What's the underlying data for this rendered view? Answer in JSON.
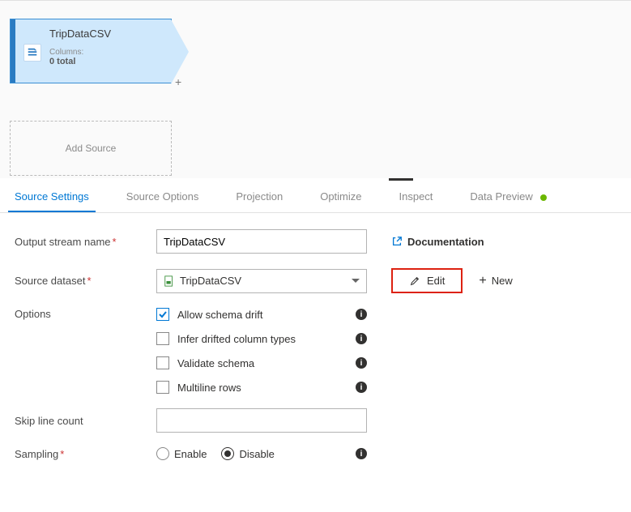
{
  "node": {
    "title": "TripDataCSV",
    "columnsLabel": "Columns:",
    "columnsCount": "0 total"
  },
  "addSource": "Add Source",
  "tabs": {
    "source_settings": "Source Settings",
    "source_options": "Source Options",
    "projection": "Projection",
    "optimize": "Optimize",
    "inspect": "Inspect",
    "data_preview": "Data Preview"
  },
  "labels": {
    "output_stream": "Output stream name",
    "source_dataset": "Source dataset",
    "options": "Options",
    "skip_line_count": "Skip line count",
    "sampling": "Sampling"
  },
  "fields": {
    "output_stream_value": "TripDataCSV",
    "source_dataset_value": "TripDataCSV",
    "skip_line_value": ""
  },
  "options": {
    "allow_schema_drift": "Allow schema drift",
    "infer_drifted": "Infer drifted column types",
    "validate_schema": "Validate schema",
    "multiline_rows": "Multiline rows"
  },
  "sampling": {
    "enable": "Enable",
    "disable": "Disable"
  },
  "actions": {
    "documentation": "Documentation",
    "edit": "Edit",
    "new": "New"
  }
}
